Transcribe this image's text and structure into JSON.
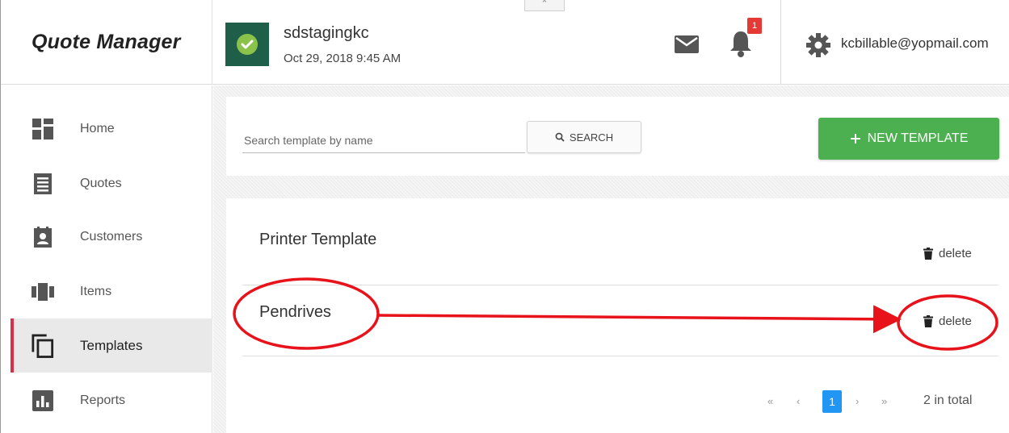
{
  "app": {
    "title": "Quote Manager"
  },
  "header": {
    "account_name": "sdstagingkc",
    "account_date": "Oct 29, 2018 9:45 AM",
    "notification_count": "1",
    "user_email": "kcbillable@yopmail.com",
    "collapse_glyph": "⌃"
  },
  "sidebar": {
    "items": [
      {
        "label": "Home",
        "icon": "home-tiles-icon"
      },
      {
        "label": "Quotes",
        "icon": "document-list-icon"
      },
      {
        "label": "Customers",
        "icon": "contact-card-icon"
      },
      {
        "label": "Items",
        "icon": "items-icon"
      },
      {
        "label": "Templates",
        "icon": "copy-icon",
        "active": true
      },
      {
        "label": "Reports",
        "icon": "bar-chart-icon"
      }
    ]
  },
  "toolbar": {
    "search_placeholder": "Search template by name",
    "search_label": "SEARCH",
    "new_template_label": "NEW TEMPLATE"
  },
  "templates": [
    {
      "name": "Printer Template",
      "delete_label": "delete"
    },
    {
      "name": "Pendrives",
      "delete_label": "delete"
    }
  ],
  "pagination": {
    "first": "«",
    "prev": "‹",
    "current": "1",
    "next": "›",
    "last": "»",
    "total_text": "2 in total"
  },
  "colors": {
    "accent_green": "#4caf50",
    "active_nav_bar": "#d9304a",
    "page_blue": "#2196f3",
    "annotation_red": "#e8121a",
    "badge_red": "#e53935",
    "brand_dark_green": "#1f5f4a"
  }
}
